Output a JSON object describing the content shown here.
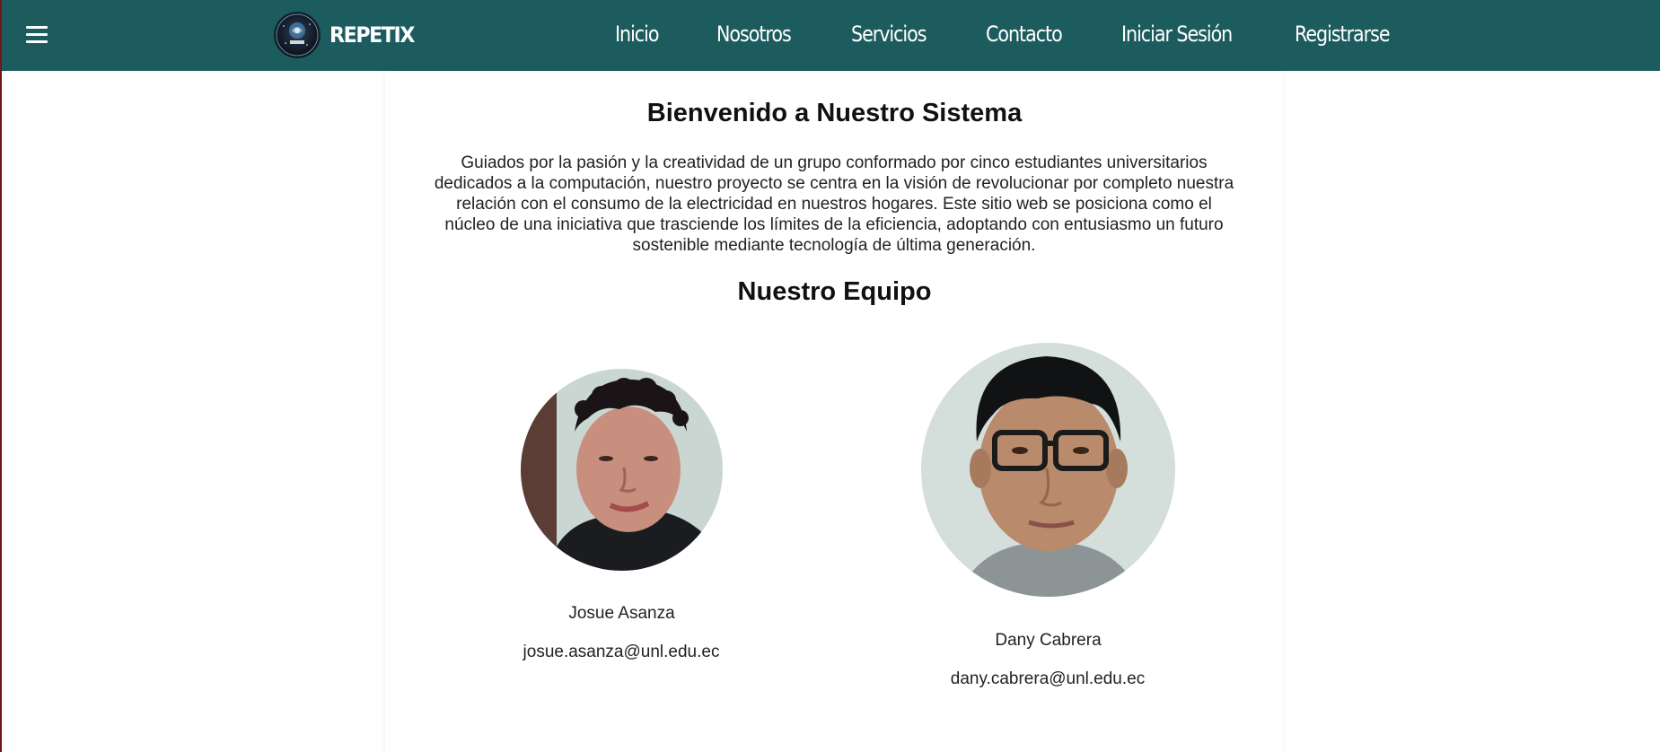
{
  "navbar": {
    "brand_name": "REPETIX",
    "menu_icon": "hamburger-menu-icon",
    "links": [
      {
        "label": "Inicio"
      },
      {
        "label": "Nosotros"
      },
      {
        "label": "Servicios"
      },
      {
        "label": "Contacto"
      },
      {
        "label": "Iniciar Sesión"
      },
      {
        "label": "Registrarse"
      }
    ],
    "colors": {
      "background": "#1c5c5f",
      "text": "#ffffff"
    }
  },
  "main": {
    "welcome_title": "Bienvenido a Nuestro Sistema",
    "intro_lines": [
      "Guiados por la pasión y la creatividad de un grupo conformado por cinco estudiantes universitarios",
      "dedicados a la computación, nuestro proyecto se centra en la visión de revolucionar por completo nuestra",
      "relación con el consumo de la electricidad en nuestros hogares. Este sitio web se posiciona como el",
      "núcleo de una iniciativa que trasciende los límites de la eficiencia, adoptando con entusiasmo un futuro",
      "sostenible mediante tecnología de última generación."
    ],
    "team_title": "Nuestro Equipo",
    "team": [
      {
        "name": "Josue Asanza",
        "email": "josue.asanza@unl.edu.ec"
      },
      {
        "name": "Dany Cabrera",
        "email": "dany.cabrera@unl.edu.ec"
      }
    ]
  }
}
